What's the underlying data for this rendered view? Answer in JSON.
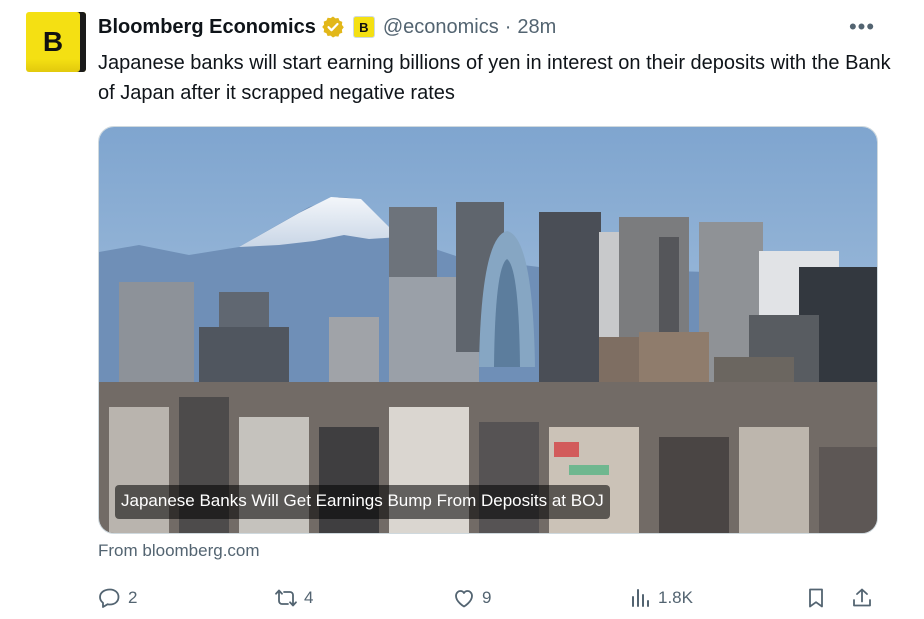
{
  "tweet": {
    "author_name": "Bloomberg Economics",
    "avatar_letter": "B",
    "affiliate_badge_letter": "B",
    "handle": "@economics",
    "separator": "·",
    "time": "28m",
    "more_label": "•••",
    "text": "Japanese banks will start earning billions of yen in interest on their deposits with the Bank of Japan after it scrapped negative rates",
    "card_title": "Japanese Banks Will Get Earnings Bump From Deposits at BOJ",
    "source": "From bloomberg.com"
  },
  "actions": {
    "replies": "2",
    "reposts": "4",
    "likes": "9",
    "views": "1.8K"
  },
  "colors": {
    "text": "#0f1419",
    "secondary": "#536471",
    "brand_yellow": "#f4e013",
    "verified_gold": "#e2b719"
  },
  "icons": [
    "verified-badge-icon",
    "more-icon",
    "reply-icon",
    "repost-icon",
    "like-icon",
    "views-icon",
    "bookmark-icon",
    "share-icon"
  ]
}
